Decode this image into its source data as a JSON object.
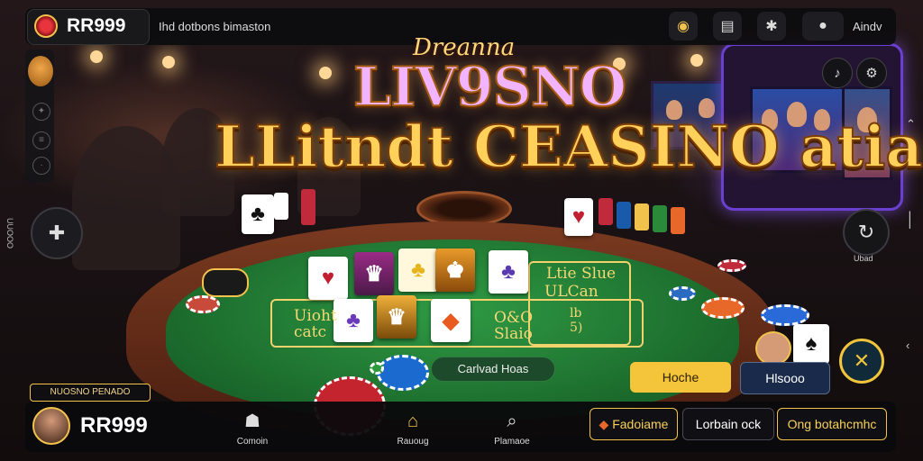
{
  "header": {
    "brand": "RR999",
    "subtitle": "Ihd dotbons bimaston",
    "right_label": "Aindv",
    "icons": [
      "coins-icon",
      "shop-icon",
      "settings-icon",
      "toggle-icon"
    ]
  },
  "hero": {
    "script_title": "Dreanna",
    "title_line1": "LIV9SNO",
    "title_line2": "LLitndt CEASINO atia"
  },
  "table": {
    "felt_text_right_1": "Ltie Slue",
    "felt_text_right_2": "ULCan",
    "felt_text_left": "Uioht\ncatc",
    "felt_text_mid_right": "O&O\nSlaio",
    "felt_text_chip": "lb\n5)"
  },
  "actions": {
    "pill_label": "Carlvad Hoas",
    "yellow_button": "Hoche",
    "dark_button": "Hlsooo",
    "refresh_label": "Ubad",
    "promo_tag": "NUOSNO PENADO",
    "side_label": "UUOOO"
  },
  "bottom": {
    "brand": "RR999",
    "nav": [
      {
        "icon": "chef-hat-icon",
        "label": "Comoin"
      },
      {
        "icon": "home-icon",
        "label": "Rauoug"
      },
      {
        "icon": "search-icon",
        "label": "Plamaoe"
      }
    ],
    "buttons": [
      "Fadoiame",
      "Lorbain ock",
      "Ong botahcmhc"
    ]
  },
  "colors": {
    "accent_gold": "#f2c34c",
    "felt_green": "#1b6a2c",
    "neon_purple": "#6b3fd0"
  }
}
